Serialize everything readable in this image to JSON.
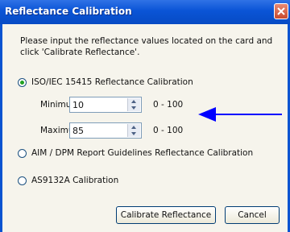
{
  "window": {
    "title": "Reflectance Calibration",
    "close_icon": "close-icon"
  },
  "instructions": "Please input the reflectance values located on the card and click 'Calibrate Reflectance'.",
  "options": [
    {
      "label": "ISO/IEC 15415 Reflectance Calibration",
      "selected": true
    },
    {
      "label": "AIM / DPM Report Guidelines Reflectance Calibration",
      "selected": false
    },
    {
      "label": "AS9132A Calibration",
      "selected": false
    }
  ],
  "fields": {
    "minimum": {
      "label": "Minimum:",
      "value": "10",
      "range": "0 - 100"
    },
    "maximum": {
      "label": "Maximum:",
      "value": "85",
      "range": "0 - 100"
    }
  },
  "annotation": {
    "icon": "arrow-left-icon",
    "color": "#0000ff"
  },
  "buttons": {
    "calibrate": "Calibrate Reflectance",
    "cancel": "Cancel"
  }
}
